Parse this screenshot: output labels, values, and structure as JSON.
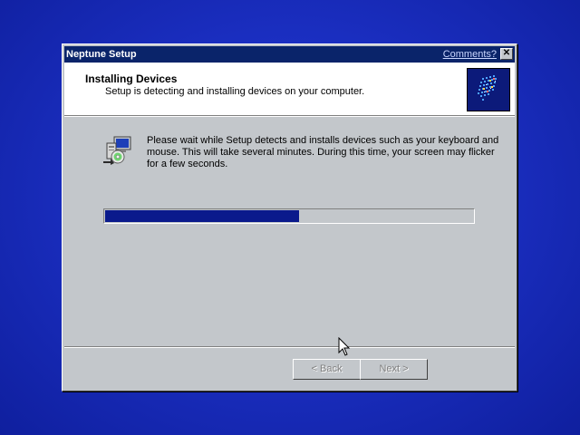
{
  "window": {
    "title": "Neptune Setup",
    "comments_label": "Comments?",
    "close_glyph": "✕"
  },
  "header": {
    "title": "Installing Devices",
    "subtitle": "Setup is detecting and installing devices on your computer.",
    "logo_icon": "setup-logo-icon"
  },
  "main": {
    "icon": "install-devices-icon",
    "message": "Please wait while Setup detects and installs devices such as your keyboard and mouse.  This will take several minutes.  During this time, your screen may flicker for a few seconds.",
    "progress_fraction": 0.53
  },
  "footer": {
    "back_label": "< Back",
    "next_label": "Next >"
  },
  "colors": {
    "desktop": "#1b2fc2",
    "titlebar": "#0a246a",
    "dialog_face": "#c3c7cb",
    "progress_fill": "#0a1a8c"
  }
}
